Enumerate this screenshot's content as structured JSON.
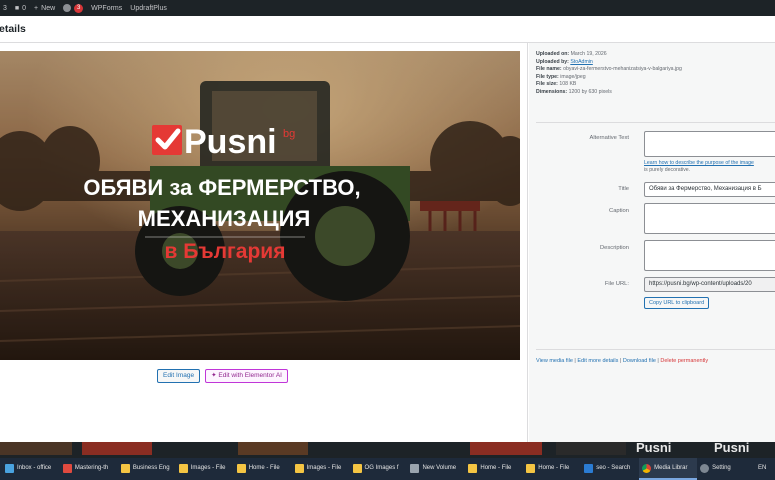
{
  "adminbar": {
    "items": [
      "3",
      "0",
      "New",
      "3",
      "WPForms",
      "UpdraftPlus"
    ],
    "badge": "3"
  },
  "modal": {
    "title": "etails"
  },
  "image": {
    "logo_text": "Pusni",
    "logo_suffix": "bg",
    "headline_line1": "ОБЯВИ за ФЕРМЕРСТВО,",
    "headline_line2": "МЕХАНИЗАЦИЯ",
    "headline_line3": "в България"
  },
  "image_buttons": {
    "edit": "Edit Image",
    "edit_ai": "Edit with Elementor AI"
  },
  "details": {
    "uploaded_on_label": "Uploaded on:",
    "uploaded_on": "March 19, 2026",
    "uploaded_by_label": "Uploaded by:",
    "uploaded_by": "StoAdmin",
    "file_name_label": "File name:",
    "file_name": "obyavi-za-fermerstvo-mehanizatsiya-v-balgariya.jpg",
    "file_type_label": "File type:",
    "file_type": "image/jpeg",
    "file_size_label": "File size:",
    "file_size": "108 KB",
    "dimensions_label": "Dimensions:",
    "dimensions": "1200 by 630 pixels"
  },
  "fields": {
    "alt_label": "Alternative Text",
    "alt_value": "",
    "alt_help_link": "Learn how to describe the purpose of the image",
    "alt_help_rest": "is purely decorative.",
    "title_label": "Title",
    "title_value": "Обяви за Фермерство, Механизация в Б",
    "caption_label": "Caption",
    "caption_value": "",
    "description_label": "Description",
    "description_value": "",
    "file_url_label": "File URL:",
    "file_url_value": "https://pusni.bg/wp-content/uploads/20",
    "copy_button": "Copy URL to clipboard"
  },
  "actions": {
    "view": "View media file",
    "sep": "|",
    "edit_details": "Edit more details",
    "download": "Download file",
    "delete": "Delete permanently"
  },
  "background": {
    "text1": "Pusni",
    "text2": "Pusni"
  },
  "taskbar": [
    {
      "label": "Inbox - office",
      "icon": "mail-icon",
      "active": false
    },
    {
      "label": "Mastering-th",
      "icon": "pdf-icon",
      "active": false
    },
    {
      "label": "Business Eng",
      "icon": "folder-icon",
      "active": false
    },
    {
      "label": "Images - File",
      "icon": "folder-icon",
      "active": false
    },
    {
      "label": "Home - File",
      "icon": "folder-icon",
      "active": false
    },
    {
      "label": "Images - File",
      "icon": "folder-icon",
      "active": false
    },
    {
      "label": "OG Images f",
      "icon": "folder-icon",
      "active": false
    },
    {
      "label": "New Volume",
      "icon": "drive-icon",
      "active": false
    },
    {
      "label": "Home - File",
      "icon": "folder-icon",
      "active": false
    },
    {
      "label": "Home - File",
      "icon": "folder-icon",
      "active": false
    },
    {
      "label": "seo - Search",
      "icon": "search-app-icon",
      "active": false
    },
    {
      "label": "Media Librar",
      "icon": "chrome-icon",
      "active": true
    },
    {
      "label": "Setting",
      "icon": "gear-icon",
      "active": false
    },
    {
      "label": "EN",
      "icon": "",
      "active": false
    }
  ],
  "colors": {
    "accent": "#2271b1",
    "danger": "#d63638",
    "logo_red": "#e53935"
  }
}
